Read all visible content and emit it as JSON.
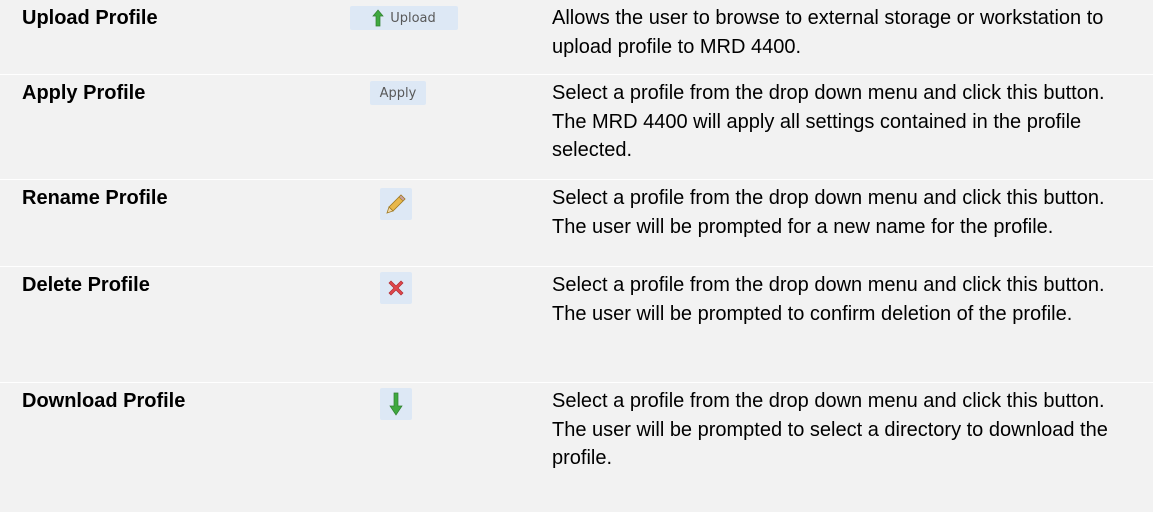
{
  "rows": [
    {
      "name": "Upload Profile",
      "button_label": "Upload",
      "icon": "upload-arrow-icon",
      "description": "Allows the user to browse to external storage or workstation to upload profile to MRD 4400."
    },
    {
      "name": "Apply Profile",
      "button_label": "Apply",
      "icon": "",
      "description": "Select a profile from the drop down menu and click this button. The MRD 4400 will apply all settings contained in the profile selected."
    },
    {
      "name": "Rename Profile",
      "button_label": "",
      "icon": "pencil-icon",
      "description": "Select a profile from the drop down menu and click this button. The user will be prompted for a new name for the profile."
    },
    {
      "name": "Delete Profile",
      "button_label": "",
      "icon": "red-x-icon",
      "description": "Select a profile from the drop down menu and click this button. The user will be prompted to confirm deletion of the profile."
    },
    {
      "name": "Download Profile",
      "button_label": "",
      "icon": "download-arrow-icon",
      "description": "Select a profile from the drop down menu and click this button. The user will be prompted to select a directory to download the profile."
    }
  ],
  "colors": {
    "row_background": "#f2f2f2",
    "button_background": "#dde8f5",
    "upload_arrow": "#3fa93f",
    "download_arrow": "#3fa93f",
    "delete_x": "#e0474c",
    "pencil": "#e8b84a"
  }
}
